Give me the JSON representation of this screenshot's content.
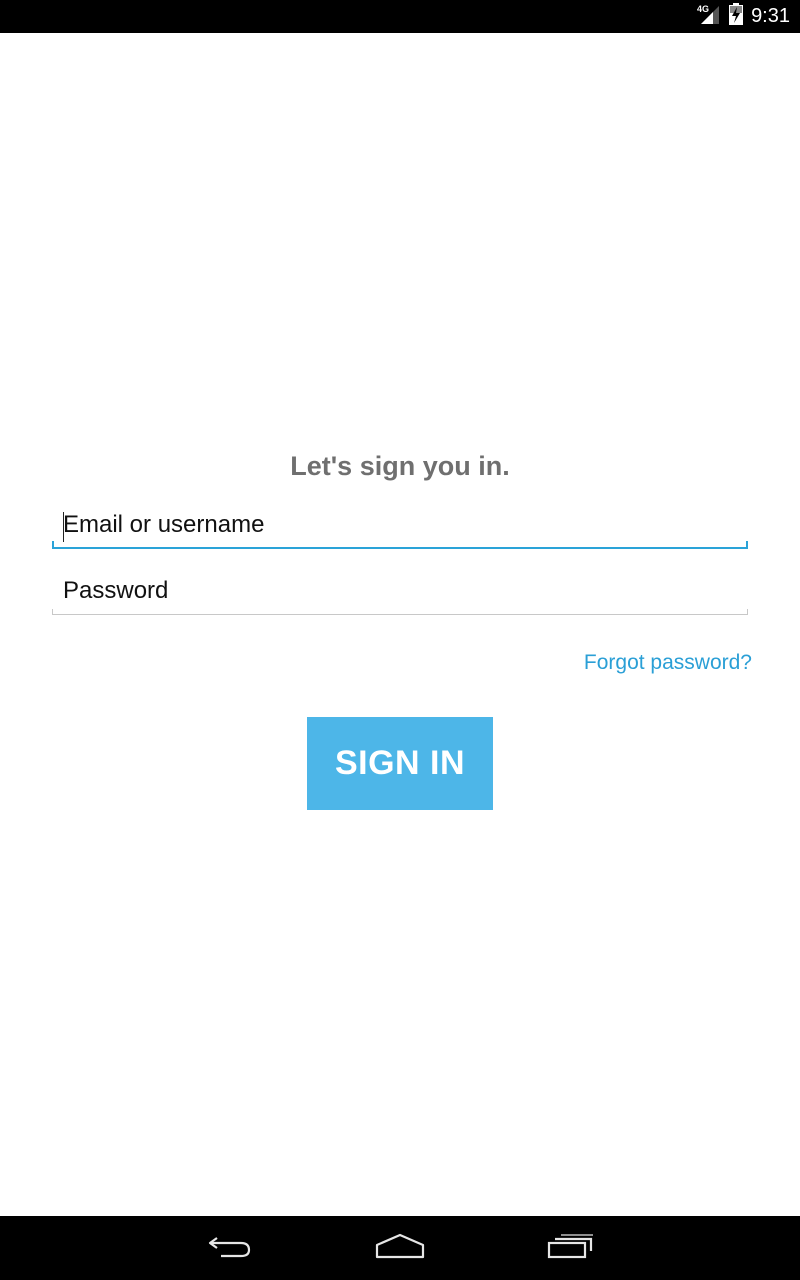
{
  "status_bar": {
    "network_label": "4G",
    "time": "9:31"
  },
  "login": {
    "title": "Let's sign you in.",
    "email_placeholder": "Email or username",
    "email_value": "",
    "password_placeholder": "Password",
    "password_value": "",
    "forgot_label": "Forgot password?",
    "sign_in_label": "SIGN IN"
  },
  "colors": {
    "accent": "#2aa3d8",
    "button": "#4db6e8",
    "title": "#6f6f6f"
  },
  "nav_bar": {
    "back_icon": "back-icon",
    "home_icon": "home-icon",
    "recents_icon": "recents-icon"
  }
}
